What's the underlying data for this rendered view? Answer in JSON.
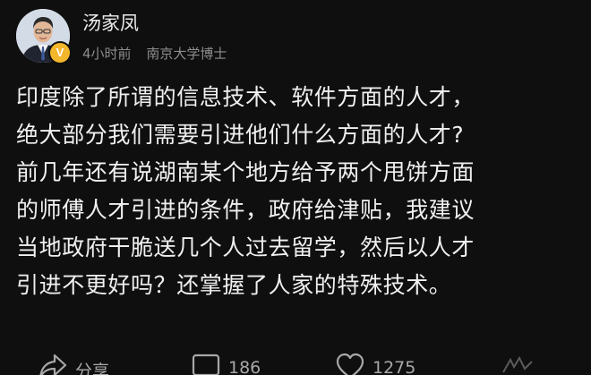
{
  "author": {
    "name": "汤家凤",
    "time": "4小时前",
    "title": "南京大学博士",
    "badge": "V"
  },
  "post": {
    "lines": [
      "印度除了所谓的信息技术、软件方面的人才，",
      "绝大部分我们需要引进他们什么方面的人才?",
      "前几年还有说湖南某个地方给予两个甩饼方面",
      "的师傅人才引进的条件，政府给津贴，我建议",
      "当地政府干脆送几个人过去留学，然后以人才",
      "引进不更好吗？还掌握了人家的特殊技术。"
    ]
  },
  "actions": {
    "share_label": "分享",
    "comment_count": "186",
    "like_count": "1275"
  },
  "colors": {
    "background": "#0f0f0f",
    "text": "#f0f0f0",
    "meta": "#8d8d8d",
    "badge": "#f3b72c"
  }
}
